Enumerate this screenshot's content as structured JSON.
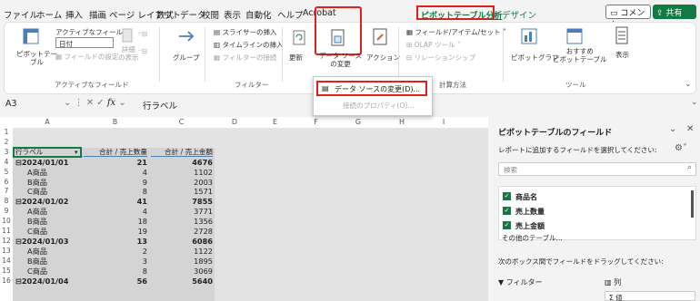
{
  "menu": {
    "tabs": [
      "ファイル",
      "ホーム",
      "挿入",
      "描画",
      "ページ レイアウト",
      "数式",
      "データ",
      "校閲",
      "表示",
      "自動化",
      "ヘルプ",
      "Acrobat",
      "ピボットテーブル分析",
      "デザイン"
    ],
    "comment": "コメント",
    "share": "共有"
  },
  "ribbon": {
    "pivottable": "ピボットテー\nブル",
    "active_field": "アクティブなフィールド:",
    "field_value": "日付",
    "field_settings": "フィールドの設定",
    "drill_down": "詳細\nの表示",
    "group": "グループ",
    "slicer": "スライサーの挿入",
    "timeline": "タイムラインの挿入",
    "filter_conn": "フィルターの接続",
    "refresh": "更新",
    "data_source": "データ ソース\nの変更",
    "action": "アクション",
    "fields_items": "フィールド/アイテム/セット",
    "olap": "OLAP ツール",
    "relationships": "リレーションシップ",
    "pivotchart": "ピボットグラフ",
    "recommended": "おすすめ\nピボットテーブル",
    "show": "表示",
    "groups": {
      "active_field": "アクティブなフィールド",
      "filter": "フィルター",
      "calc": "計算方法",
      "tools": "ツール"
    }
  },
  "dropdown": {
    "change_source": "データ ソースの変更(D)...",
    "connection_props": "接続のプロパティ(O)..."
  },
  "formula": {
    "namebox": "A3",
    "fx": "fx",
    "value": "行ラベル"
  },
  "columns": [
    "A",
    "B",
    "C",
    "D",
    "E",
    "F",
    "G",
    "H",
    "I"
  ],
  "rows": [
    {
      "n": "1",
      "a": "",
      "b": "",
      "c": ""
    },
    {
      "n": "2",
      "a": "",
      "b": "",
      "c": ""
    },
    {
      "n": "3",
      "a": "行ラベル",
      "b": "合計 / 売上数量",
      "c": "合計 / 売上金額",
      "header": true
    },
    {
      "n": "4",
      "a": "⊟2024/01/01",
      "b": "21",
      "c": "4676",
      "group": true
    },
    {
      "n": "5",
      "a": "A商品",
      "b": "4",
      "c": "1102"
    },
    {
      "n": "6",
      "a": "B商品",
      "b": "9",
      "c": "2003"
    },
    {
      "n": "7",
      "a": "C商品",
      "b": "8",
      "c": "1571"
    },
    {
      "n": "8",
      "a": "⊟2024/01/02",
      "b": "41",
      "c": "7855",
      "group": true
    },
    {
      "n": "9",
      "a": "A商品",
      "b": "4",
      "c": "3771"
    },
    {
      "n": "10",
      "a": "B商品",
      "b": "18",
      "c": "1356"
    },
    {
      "n": "11",
      "a": "C商品",
      "b": "19",
      "c": "2728"
    },
    {
      "n": "12",
      "a": "⊟2024/01/03",
      "b": "13",
      "c": "6086",
      "group": true
    },
    {
      "n": "13",
      "a": "A商品",
      "b": "2",
      "c": "1122"
    },
    {
      "n": "14",
      "a": "B商品",
      "b": "3",
      "c": "1895"
    },
    {
      "n": "15",
      "a": "C商品",
      "b": "8",
      "c": "3069"
    },
    {
      "n": "16",
      "a": "⊟2024/01/04",
      "b": "56",
      "c": "5640",
      "group": true
    }
  ],
  "pane": {
    "title": "ピボットテーブルのフィールド",
    "subtitle": "レポートに追加するフィールドを選択してください:",
    "search": "検索",
    "fields": [
      "商品名",
      "売上数量",
      "売上金額"
    ],
    "other": "その他のテーブル...",
    "drag": "次のボックス間でフィールドをドラッグしてください:",
    "filter": "フィルター",
    "columns_area": "列",
    "values_item": "Σ 値"
  },
  "colors": {
    "accent": "#107c41",
    "highlight": "#e0201b"
  }
}
